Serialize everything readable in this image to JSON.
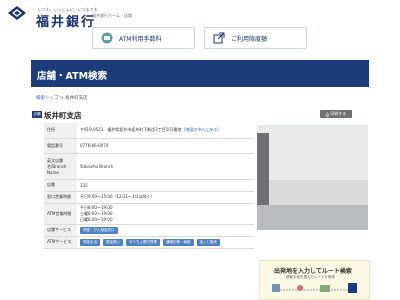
{
  "header": {
    "tagline": "いつも、いっしょに、いつまでも",
    "bank_name": "福井銀行",
    "sub_text": "福井銀行ホーム › 店舗"
  },
  "nav": {
    "atm_fee_label": "ATM利用手数料",
    "hours_label": "ご利用限度額"
  },
  "page_title": "店舗・ATM検索",
  "breadcrumb": {
    "top_label": "検索トップ",
    "separator": " > ",
    "current": "坂井町支店"
  },
  "branch": {
    "badge": "店舗",
    "name": "坂井町支店",
    "print_label": "印刷する"
  },
  "details": {
    "address_label": "住所",
    "address_value": "〒919-0523　福井県坂井市坂井町下新庄2丁目103番地",
    "map_link": "［地図の中心に戻る］",
    "phone_label": "電話番号",
    "phone_value": "0776-66-0074",
    "english_label": "英文店舗名/Branch Name",
    "english_value": "Sakaicho Branch",
    "code_label": "店番",
    "code_value": "332",
    "window_label": "窓口営業時間",
    "window_value": "平日9:00～15:00（12/31～1/3は除く）",
    "atm_hours_label": "ATM営業時間",
    "atm_hours_weekday": "平日8:00～19:00",
    "atm_hours_sat": "土曜8:00～19:00",
    "atm_hours_sun": "日曜8:00～19:00",
    "store_services_label": "店舗サービス",
    "store_services": [
      "資産・びん相談窓口"
    ],
    "atm_services_label": "ATMサービス",
    "atm_services": [
      "現金引出",
      "現金預入",
      "ゆうちょ銀行提携",
      "通帳記帳・繰越",
      "宝くじ販売"
    ]
  },
  "route": {
    "title": "出発地を入力してルート検索",
    "sub": "移動手段を選んでルートを検索"
  },
  "colors": {
    "brand_navy": "#1b3b7a",
    "link_blue": "#3a66b0",
    "tag_blue": "#4f82c4",
    "route_bg": "#fbf8e3"
  },
  "icons": {
    "logo": "diamond-logo-icon",
    "atm": "atm-card-icon",
    "hours": "external-link-icon",
    "print": "printer-icon"
  }
}
